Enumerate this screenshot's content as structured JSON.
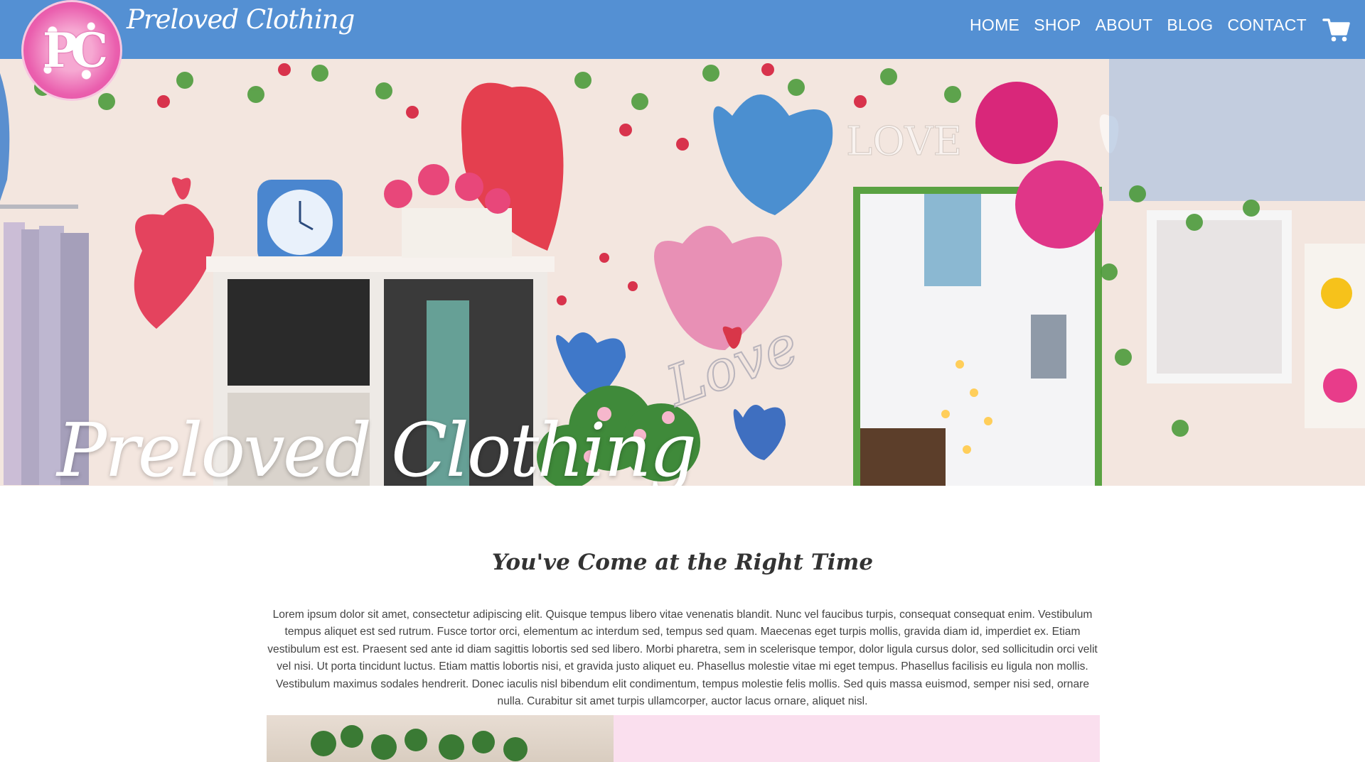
{
  "header": {
    "logo_monogram": "PC",
    "brand": "Preloved Clothing",
    "nav": [
      {
        "label": "HOME"
      },
      {
        "label": "SHOP"
      },
      {
        "label": "ABOUT"
      },
      {
        "label": "BLOG"
      },
      {
        "label": "CONTACT"
      }
    ],
    "cart_icon": "shopping-cart-icon"
  },
  "hero": {
    "title": "Preloved Clothing",
    "wall_text": [
      "LOVE",
      "Love"
    ]
  },
  "intro": {
    "heading": "You've Come at the Right Time",
    "body": "Lorem ipsum dolor sit amet, consectetur adipiscing elit. Quisque tempus libero vitae venenatis blandit. Nunc vel faucibus turpis, consequat consequat enim. Vestibulum tempus aliquet est sed rutrum. Fusce tortor orci, elementum ac interdum sed, tempus sed quam. Maecenas eget turpis mollis, gravida diam id, imperdiet ex. Etiam vestibulum est est. Praesent sed ante id diam sagittis lobortis sed sed libero. Morbi pharetra, sem in scelerisque tempor, dolor ligula cursus dolor, sed sollicitudin orci velit vel nisi. Ut porta tincidunt luctus. Etiam mattis lobortis nisi, et gravida justo aliquet eu. Phasellus molestie vitae mi eget tempus. Phasellus facilisis eu ligula non mollis. Vestibulum maximus sodales hendrerit. Donec iaculis nisl bibendum elit condimentum, tempus molestie felis mollis. Sed quis massa euismod, semper nisi sed, ornare nulla. Curabitur sit amet turpis ullamcorper, auctor lacus ornare, aliquet nisl."
  },
  "colors": {
    "header": "#5490d3",
    "accent_pink": "#e3479f",
    "panel_pink": "#fadfee",
    "text": "#444444"
  }
}
